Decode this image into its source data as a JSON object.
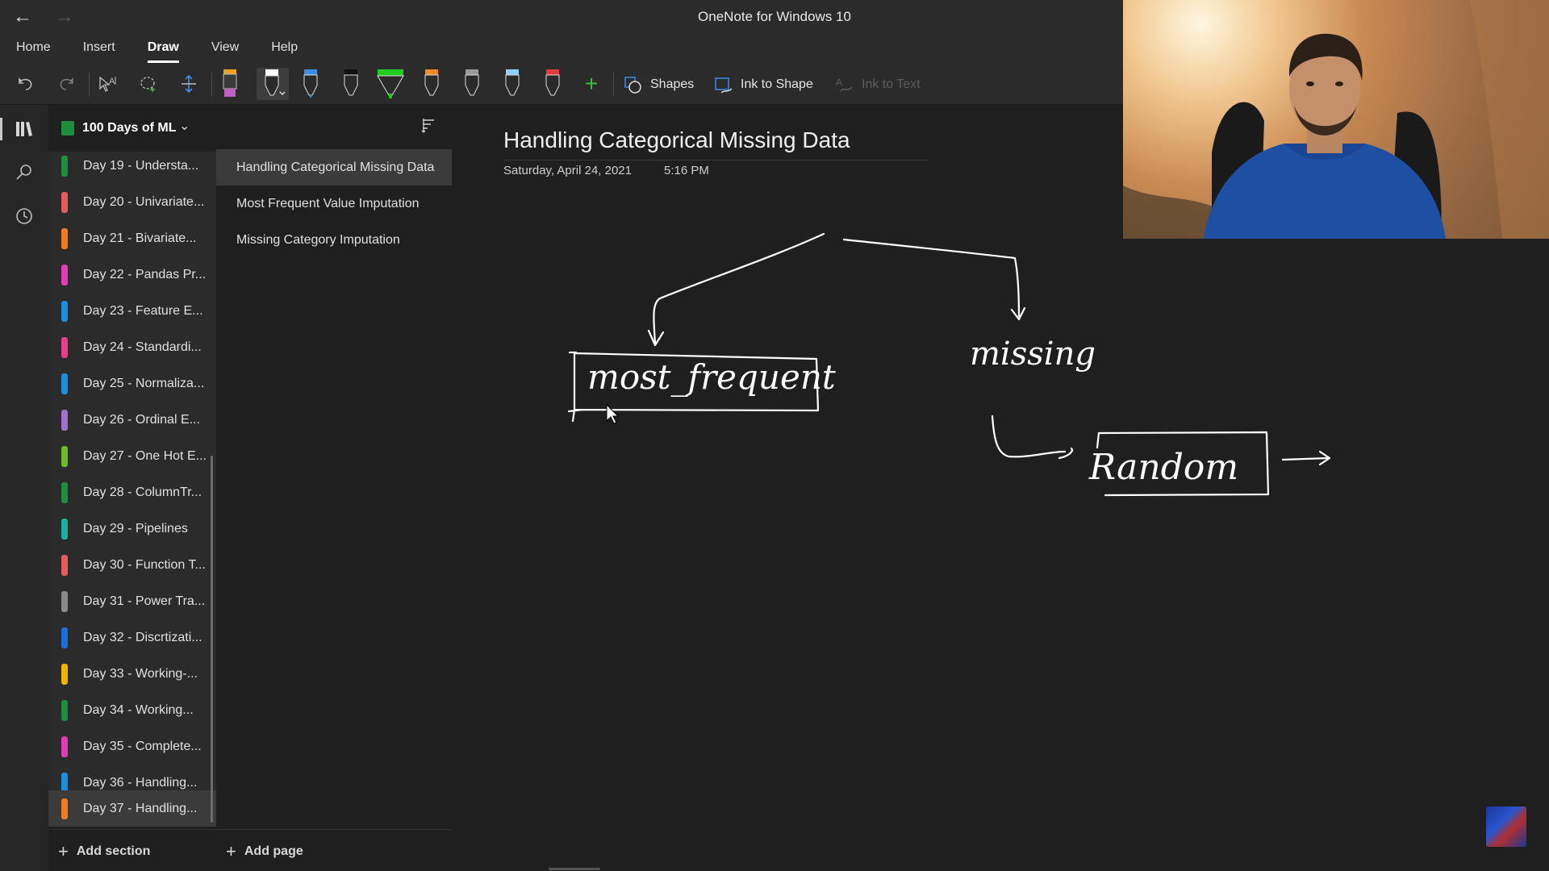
{
  "app": {
    "title": "OneNote for Windows 10"
  },
  "ribbon": {
    "tabs": [
      "Home",
      "Insert",
      "Draw",
      "View",
      "Help"
    ],
    "active_tab": "Draw",
    "commands": {
      "shapes": "Shapes",
      "ink_to_shape": "Ink to Shape",
      "ink_to_text": "Ink to Text"
    },
    "pens": [
      {
        "name": "highlighter-pen",
        "color": "#c060c0"
      },
      {
        "name": "pen-white",
        "color": "#ffffff"
      },
      {
        "name": "pen-blue",
        "color": "#3a8ee6"
      },
      {
        "name": "pen-black",
        "color": "#202020"
      },
      {
        "name": "highlighter-green",
        "color": "#22cc22"
      },
      {
        "name": "pen-orange",
        "color": "#f08a24"
      },
      {
        "name": "pen-gray",
        "color": "#9a9a9a"
      },
      {
        "name": "pen-lightblue",
        "color": "#8fd0ff"
      },
      {
        "name": "pen-red",
        "color": "#e23c3c"
      }
    ]
  },
  "notebook": {
    "name": "100 Days of ML",
    "color": "#1e8e3e"
  },
  "sections": [
    {
      "label": "Day 19 - Understa...",
      "color": "#1e8e3e"
    },
    {
      "label": "Day 20 - Univariate...",
      "color": "#e8595b"
    },
    {
      "label": "Day 21 - Bivariate...",
      "color": "#f07c1e"
    },
    {
      "label": "Day 22 - Pandas Pr...",
      "color": "#e23bb7"
    },
    {
      "label": "Day 23 - Feature E...",
      "color": "#1a8fe0"
    },
    {
      "label": "Day 24 - Standardi...",
      "color": "#e83e8c"
    },
    {
      "label": "Day 25 - Normaliza...",
      "color": "#1a8fe0"
    },
    {
      "label": "Day 26 - Ordinal E...",
      "color": "#a070d0"
    },
    {
      "label": "Day 27 - One Hot E...",
      "color": "#6cbd2a"
    },
    {
      "label": "Day 28 - ColumnTr...",
      "color": "#1e8e3e"
    },
    {
      "label": "Day 29 - Pipelines",
      "color": "#1ab0a0"
    },
    {
      "label": "Day 30 - Function T...",
      "color": "#e8595b"
    },
    {
      "label": "Day 31 - Power Tra...",
      "color": "#8a8a8a"
    },
    {
      "label": "Day 32 - Discrtizati...",
      "color": "#1a6fe0"
    },
    {
      "label": "Day 33 - Working-...",
      "color": "#f2b400"
    },
    {
      "label": "Day 34 - Working...",
      "color": "#1e8e3e"
    },
    {
      "label": "Day 35 - Complete...",
      "color": "#e23bb7"
    },
    {
      "label": "Day 36 - Handling...",
      "color": "#1a8fe0"
    },
    {
      "label": "Day 37 - Handling...",
      "color": "#f07c1e"
    }
  ],
  "selected_section_index": 18,
  "pages": [
    {
      "label": "Handling Categorical Missing Data"
    },
    {
      "label": "Most Frequent Value Imputation"
    },
    {
      "label": "Missing Category Imputation"
    }
  ],
  "selected_page_index": 0,
  "bottom": {
    "add_section": "Add section",
    "add_page": "Add page"
  },
  "page": {
    "title": "Handling Categorical Missing Data",
    "date": "Saturday, April 24, 2021",
    "time": "5:16 PM"
  },
  "ink_text": [
    "most_frequent",
    "missing",
    "Random"
  ]
}
